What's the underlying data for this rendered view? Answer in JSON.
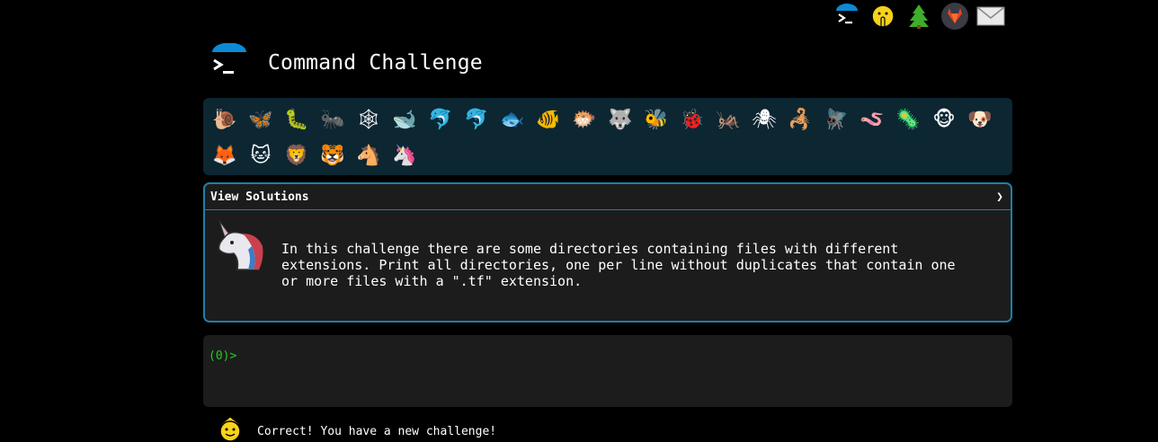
{
  "top_icons": [
    {
      "name": "terminal-icon"
    },
    {
      "name": "shushing-face-icon"
    },
    {
      "name": "tree-icon"
    },
    {
      "name": "gitlab-icon"
    },
    {
      "name": "envelope-icon"
    }
  ],
  "header": {
    "title": "Command Challenge"
  },
  "emoji_rows": [
    [
      "🐌",
      "🦋",
      "🐛",
      "🐜",
      "🕸",
      "🐋",
      "🐬",
      "🐬",
      "🐟",
      "🐠",
      "🐡",
      "🐺",
      "🐝",
      "🐞",
      "🦗",
      "🕷",
      "🦂",
      "🪰",
      "🪱",
      "🦠",
      "🐵",
      "🐶"
    ],
    [
      "🦊",
      "🐱",
      "🦁",
      "🐯",
      "🐴",
      "🦄"
    ]
  ],
  "panel": {
    "header": "View Solutions",
    "toggle": "❯",
    "description": "In this challenge there are some directories containing files with different\nextensions. Print all directories, one per line without duplicates that contain one\nor more files with a \".tf\" extension."
  },
  "terminal": {
    "prompt": "(0)>"
  },
  "status": {
    "message": "Correct! You have a new challenge!"
  },
  "colors": {
    "accent": "#1f7fa8",
    "prompt": "#22cc22",
    "emoji_bar": "#0c2632",
    "panel_bg": "#1c1c1c"
  }
}
